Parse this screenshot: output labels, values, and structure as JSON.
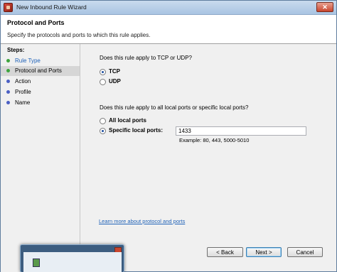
{
  "window": {
    "title": "New Inbound Rule Wizard",
    "close_glyph": "✕"
  },
  "header": {
    "title": "Protocol and Ports",
    "subtitle": "Specify the protocols and ports to which this rule applies."
  },
  "steps": {
    "title": "Steps:",
    "items": [
      {
        "label": "Rule Type",
        "state": "done"
      },
      {
        "label": "Protocol and Ports",
        "state": "current"
      },
      {
        "label": "Action",
        "state": "todo"
      },
      {
        "label": "Profile",
        "state": "todo"
      },
      {
        "label": "Name",
        "state": "todo"
      }
    ]
  },
  "protocol": {
    "question": "Does this rule apply to TCP or UDP?",
    "options": [
      "TCP",
      "UDP"
    ],
    "selected": "TCP"
  },
  "ports": {
    "question": "Does this rule apply to all local ports or specific local ports?",
    "options": [
      "All local ports",
      "Specific local ports:"
    ],
    "selected": "Specific local ports:",
    "value": "1433",
    "example": "Example: 80, 443, 5000-5010"
  },
  "link_text": "Learn more about protocol and ports",
  "buttons": {
    "back": "< Back",
    "next": "Next >",
    "cancel": "Cancel"
  }
}
